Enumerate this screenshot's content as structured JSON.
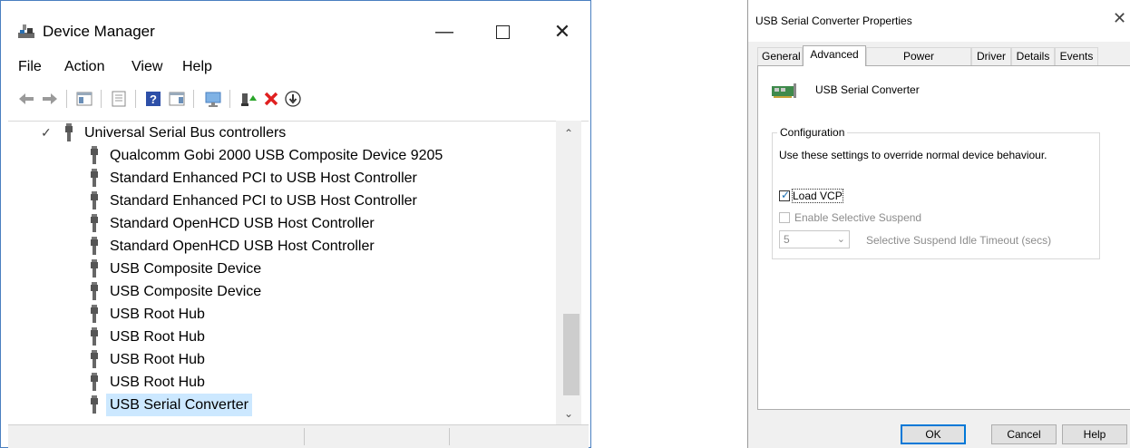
{
  "device_manager": {
    "title": "Device Manager",
    "window_buttons": {
      "minimize": "—",
      "maximize": "",
      "close": "✕"
    },
    "menu": [
      "File",
      "Action",
      "View",
      "Help"
    ],
    "tree": {
      "category": "Universal Serial Bus controllers",
      "items": [
        "Qualcomm Gobi 2000 USB Composite Device 9205",
        "Standard Enhanced PCI to USB Host Controller",
        "Standard Enhanced PCI to USB Host Controller",
        "Standard OpenHCD USB Host Controller",
        "Standard OpenHCD USB Host Controller",
        "USB Composite Device",
        "USB Composite Device",
        "USB Root Hub",
        "USB Root Hub",
        "USB Root Hub",
        "USB Root Hub",
        "USB Serial Converter"
      ],
      "selected": "USB Serial Converter"
    }
  },
  "properties": {
    "title": "USB Serial Converter Properties",
    "close": "✕",
    "tabs": [
      "General",
      "Advanced",
      "Power Management",
      "Driver",
      "Details",
      "Events"
    ],
    "active_tab": "Advanced",
    "device_name": "USB Serial Converter",
    "group_label": "Configuration",
    "description": "Use these settings to override normal device behaviour.",
    "load_vcp": {
      "label": "Load VCP",
      "checked": true
    },
    "selective_suspend": {
      "label": "Enable Selective Suspend",
      "checked": false,
      "enabled": false
    },
    "timeout": {
      "value": "5",
      "label": "Selective Suspend Idle Timeout (secs)"
    },
    "buttons": {
      "ok": "OK",
      "cancel": "Cancel",
      "help": "Help"
    }
  },
  "colors": {
    "selection": "#cce8ff",
    "accent": "#0078d7",
    "window_border": "#4a7fc0"
  }
}
